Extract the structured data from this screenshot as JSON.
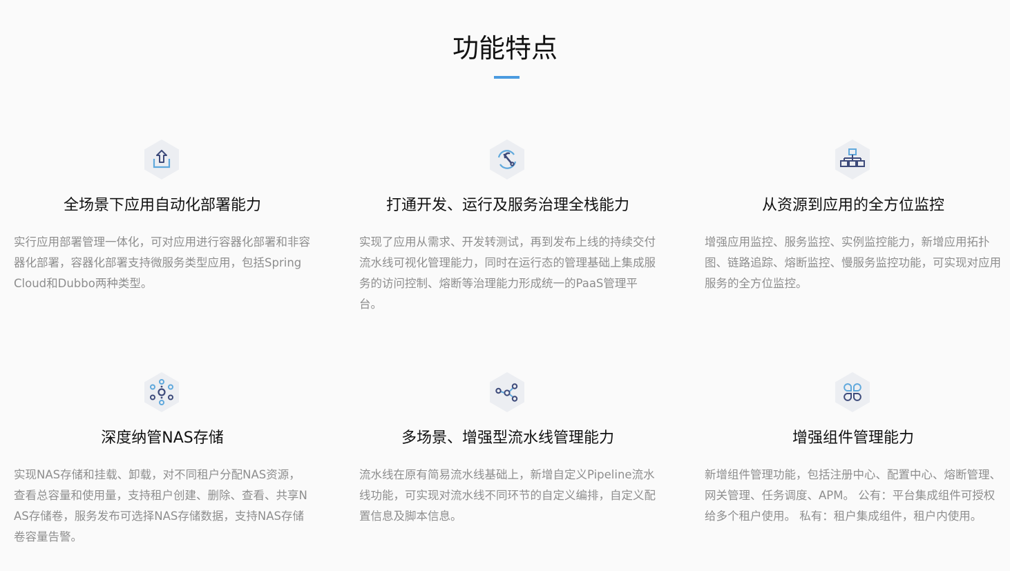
{
  "header": {
    "title": "功能特点"
  },
  "colors": {
    "accent": "#4a9be0",
    "icon_dark": "#3d4a7a",
    "icon_light": "#5fa8dc",
    "hexagon_bg": "#eceef2"
  },
  "features": [
    {
      "icon": "upload-tray-icon",
      "title": "全场景下应用自动化部署能力",
      "desc": "实行应用部署管理一体化，可对应用进行容器化部署和非容器化部署，容器化部署支持微服务类型应用，包括Spring Cloud和Dubbo两种类型。"
    },
    {
      "icon": "wrench-refresh-icon",
      "title": "打通开发、运行及服务治理全栈能力",
      "desc": "实现了应用从需求、开发转测试，再到发布上线的持续交付流水线可视化管理能力，同时在运行态的管理基础上集成服务的访问控制、熔断等治理能力形成统一的PaaS管理平台。"
    },
    {
      "icon": "hierarchy-tree-icon",
      "title": "从资源到应用的全方位监控",
      "desc": "增强应用监控、服务监控、实例监控能力，新增应用拓扑图、链路追踪、熔断监控、慢服务监控功能，可实现对应用服务的全方位监控。"
    },
    {
      "icon": "network-nodes-icon",
      "title": "深度纳管NAS存储",
      "desc": "实现NAS存储和挂载、卸载，对不同租户分配NAS资源，查看总容量和使用量，支持租户创建、删除、查看、共享NAS存储卷，服务发布可选择NAS存储数据，支持NAS存储卷容量告警。"
    },
    {
      "icon": "pipeline-nodes-icon",
      "title": "多场景、增强型流水线管理能力",
      "desc": "流水线在原有简易流水线基础上，新增自定义Pipeline流水线功能，可实现对流水线不同环节的自定义编排，自定义配置信息及脚本信息。"
    },
    {
      "icon": "component-grid-icon",
      "title": "增强组件管理能力",
      "desc": "新增组件管理功能，包括注册中心、配置中心、熔断管理、网关管理、任务调度、APM。 公有：平台集成组件可授权给多个租户使用。 私有：租户集成组件，租户内使用。"
    }
  ]
}
